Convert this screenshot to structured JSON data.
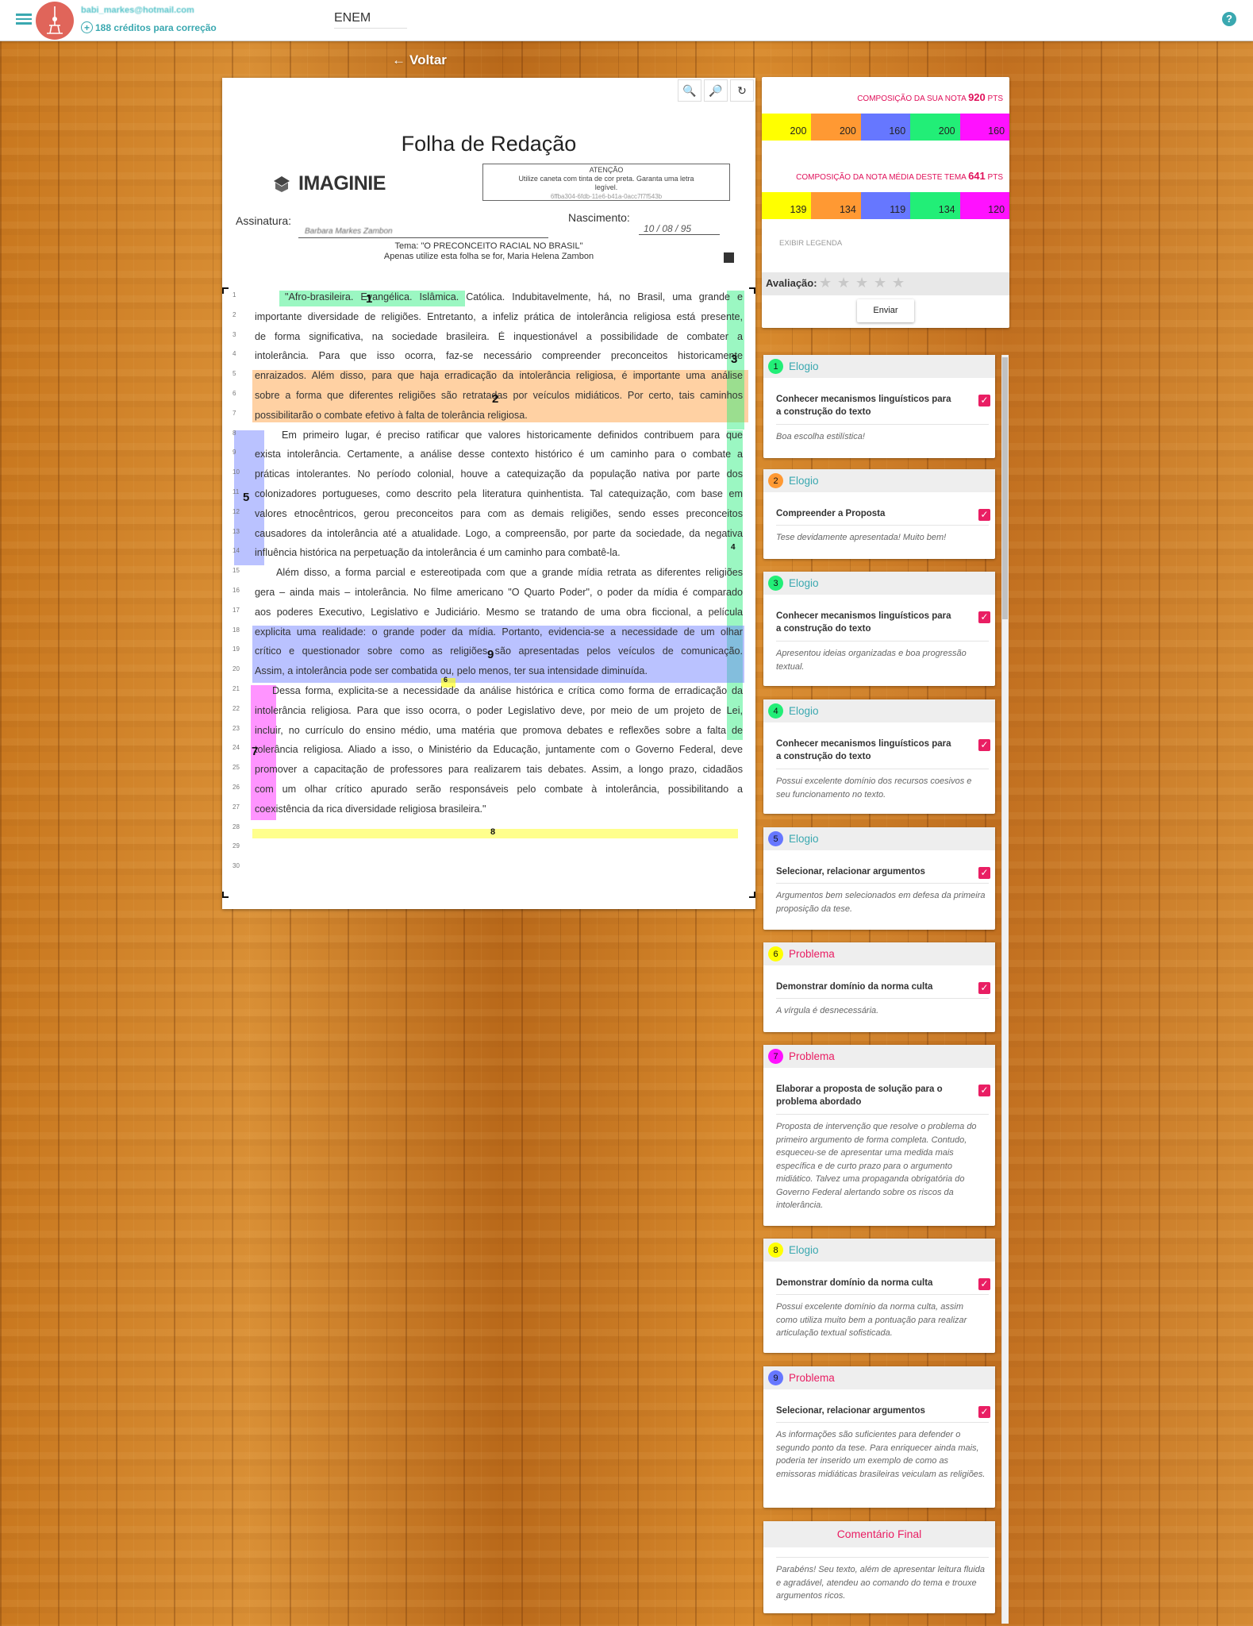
{
  "header": {
    "email": "babi_markes@hotmail.com",
    "credits": "188 créditos para correção",
    "exam": "ENEM",
    "help": "?"
  },
  "back_label": "Voltar",
  "sheet": {
    "title": "Folha de Redação",
    "logo": "IMAGINIE",
    "attention_title": "ATENÇÃO",
    "attention_line1": "Utilize caneta com tinta de cor preta. Garanta uma letra",
    "attention_line2": "legível.",
    "attention_id": "6ffba304-6fdb-11e6-b41a-0acc7f7f543b",
    "signature_label": "Assinatura:",
    "signature_value": "Barbara Markes Zambon",
    "birth_label": "Nascimento:",
    "birth_value": "10 / 08 / 95",
    "tema_line": "Tema: \"O PRECONCEITO RACIAL NO BRASIL\"",
    "tema_sub": "Apenas utilize esta folha se for, Maria Helena Zambon",
    "lines": [
      "\"Afro-brasileira. Evangélica. Islâmica. Católica. Indubitavelmente, há, no Brasil, uma grande e",
      "importante diversidade de religiões. Entretanto, a infeliz prática de intolerância religiosa está presente,",
      "de forma significativa, na sociedade brasileira. É inquestionável a possibilidade de combater a",
      "intolerância. Para que isso ocorra, faz-se necessário compreender preconceitos historicamente",
      "enraizados. Além disso, para que haja erradicação da intolerância religiosa, é importante uma análise",
      "sobre a forma que diferentes religiões são retratadas por veículos midiáticos. Por certo, tais caminhos",
      "possibilitarão o combate efetivo à falta de tolerância religiosa.",
      "Em primeiro lugar, é preciso ratificar que valores historicamente definidos contribuem para que",
      "exista intolerância. Certamente, a análise desse contexto histórico é um caminho para o combate a",
      "práticas intolerantes. No período colonial, houve a catequização da população nativa por parte dos",
      "colonizadores portugueses, como descrito pela literatura quinhentista. Tal catequização, com base em",
      "valores etnocêntricos, gerou preconceitos para com as demais religiões, sendo esses preconceitos",
      "causadores da intolerância até a atualidade. Logo, a compreensão, por parte da sociedade, da negativa",
      "influência histórica na perpetuação da intolerância é um caminho para combatê-la.",
      "Além disso, a forma parcial e estereotipada com que a grande mídia retrata as diferentes religiões",
      "gera – ainda mais – intolerância. No filme americano \"O Quarto Poder\", o poder da mídia é comparado",
      "aos poderes Executivo, Legislativo e Judiciário. Mesmo se tratando de uma obra ficcional, a película",
      "explicita uma realidade: o grande poder da mídia. Portanto, evidencia-se a necessidade de um olhar",
      "crítico e questionador sobre como as religiões são apresentadas pelos veículos de comunicação.",
      "Assim, a intolerância pode ser combatida ou, pelo menos, ter sua intensidade diminuída.",
      "Dessa forma, explicita-se a necessidade da análise histórica e crítica como forma de erradicação da",
      "intolerância religiosa. Para que isso ocorra, o poder Legislativo deve, por meio de um projeto de Lei,",
      "incluir, no currículo do ensino médio, uma matéria que promova debates e reflexões sobre a falta de",
      "tolerância religiosa. Aliado a isso, o Ministério da Educação, juntamente com o Governo Federal, deve",
      "promover a capacitação de professores para realizarem tais debates. Assim, a longo prazo, cidadãos",
      "com um olhar crítico apurado serão responsáveis pelo combate à intolerância, possibilitando a",
      "coexistência da rica diversidade religiosa brasileira.\"",
      "",
      "",
      ""
    ],
    "line_numbers": [
      "1",
      "2",
      "3",
      "4",
      "5",
      "6",
      "7",
      "8",
      "9",
      "10",
      "11",
      "12",
      "13",
      "14",
      "15",
      "16",
      "17",
      "18",
      "19",
      "20",
      "21",
      "22",
      "23",
      "24",
      "25",
      "26",
      "27",
      "28",
      "29",
      "30"
    ],
    "markers": [
      "1",
      "2",
      "3",
      "4",
      "5",
      "6",
      "7",
      "8",
      "9"
    ]
  },
  "score": {
    "label_own": "COMPOSIÇÃO DA SUA NOTA",
    "own_total": "920",
    "label_avg": "COMPOSIÇÃO DA NOTA MÉDIA DESTE TEMA",
    "avg_total": "641",
    "pts": "PTS",
    "own": [
      "200",
      "200",
      "160",
      "200",
      "160"
    ],
    "avg": [
      "139",
      "134",
      "119",
      "134",
      "120"
    ],
    "colors": [
      "#ffff00",
      "#ff9933",
      "#6677ff",
      "#22ee77",
      "#ff11ff"
    ],
    "legend": "EXIBIR LEGENDA",
    "rating_label": "Avaliação:",
    "stars": [
      "★",
      "★",
      "★",
      "★",
      "★"
    ],
    "send": "Enviar"
  },
  "feedback": [
    {
      "n": "1",
      "type": "Elogio",
      "color": "#22ee77",
      "criterion": "Conhecer mecanismos linguísticos para a construção do texto",
      "text": "Boa escolha estilística!"
    },
    {
      "n": "2",
      "type": "Elogio",
      "color": "#ff9933",
      "criterion": "Compreender a Proposta",
      "text": "Tese devidamente apresentada! Muito bem!"
    },
    {
      "n": "3",
      "type": "Elogio",
      "color": "#22ee77",
      "criterion": "Conhecer mecanismos linguísticos para a construção do texto",
      "text": "Apresentou ideias organizadas e boa progressão textual."
    },
    {
      "n": "4",
      "type": "Elogio",
      "color": "#22ee77",
      "criterion": "Conhecer mecanismos linguísticos para a construção do texto",
      "text": "Possui excelente domínio dos recursos coesivos e seu funcionamento no texto."
    },
    {
      "n": "5",
      "type": "Elogio",
      "color": "#6677ff",
      "criterion": "Selecionar, relacionar argumentos",
      "text": "Argumentos bem selecionados em defesa da primeira proposição da tese."
    },
    {
      "n": "6",
      "type": "Problema",
      "color": "#ffff00",
      "criterion": "Demonstrar domínio da norma culta",
      "text": "A vírgula é desnecessária."
    },
    {
      "n": "7",
      "type": "Problema",
      "color": "#ff11ff",
      "criterion": "Elaborar a proposta de solução para o problema abordado",
      "text": "Proposta de intervenção que resolve o problema do primeiro argumento de forma completa. Contudo, esqueceu-se de apresentar uma medida mais específica e de curto prazo para o argumento midiático. Talvez uma propaganda obrigatória do Governo Federal alertando sobre os riscos da intolerância."
    },
    {
      "n": "8",
      "type": "Elogio",
      "color": "#ffff00",
      "criterion": "Demonstrar domínio da norma culta",
      "text": "Possui excelente domínio da norma culta, assim como utiliza muito bem a pontuação para realizar articulação textual sofisticada."
    },
    {
      "n": "9",
      "type": "Problema",
      "color": "#6677ff",
      "criterion": "Selecionar, relacionar argumentos",
      "text": "As informações são suficientes para defender o segundo ponto da tese. Para enriquecer ainda mais, poderia ter inserido um exemplo de como as emissoras midiáticas brasileiras veiculam as religiões."
    }
  ],
  "final": {
    "title": "Comentário Final",
    "text": "Parabéns! Seu texto, além de apresentar leitura fluida e agradável, atendeu ao comando do tema e trouxe argumentos ricos."
  },
  "colors": {
    "accent": "#3aa8b0",
    "elogio": "#3aa8b0",
    "problema": "#e91e63"
  }
}
